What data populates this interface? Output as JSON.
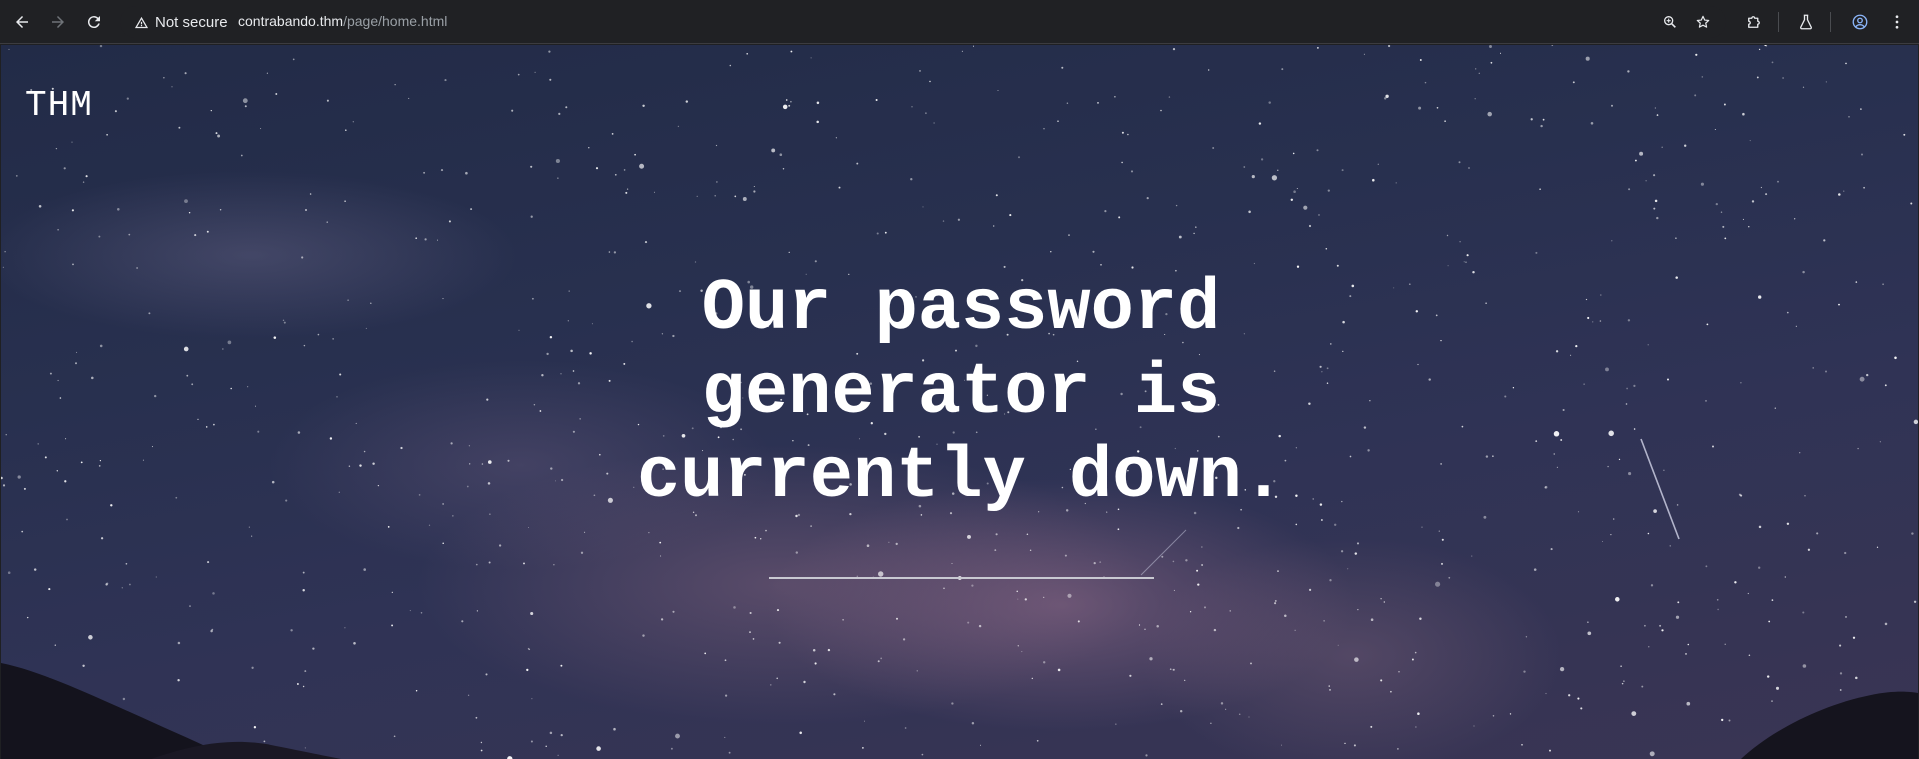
{
  "browser": {
    "security_label": "Not secure",
    "url_host": "contrabando.thm",
    "url_path": "/page/home.html",
    "icons": {
      "back": "back-arrow-icon",
      "forward": "forward-arrow-icon",
      "reload": "reload-icon",
      "security": "warning-triangle-icon",
      "zoom": "zoom-icon",
      "bookmark": "star-icon",
      "extensions": "puzzle-icon",
      "labs": "flask-icon",
      "profile": "profile-icon",
      "menu": "kebab-menu-icon"
    }
  },
  "page": {
    "brand": "THM",
    "headline_lines": [
      "Our password",
      "generator is",
      "currently down."
    ]
  },
  "colors": {
    "toolbar": "#202124",
    "sky": "#28304f",
    "text": "#ffffff"
  }
}
